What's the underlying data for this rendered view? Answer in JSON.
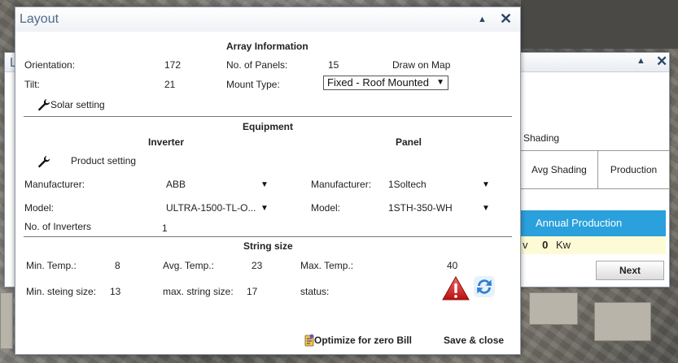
{
  "background_dialog": {
    "title_letter": "L",
    "shading_label": "Shading",
    "table_headers": {
      "avg_shading": "Avg Shading",
      "production": "Production"
    },
    "annual_production_label": "Annual Production",
    "annual_partial": "v",
    "annual_value": "0",
    "annual_unit": "Kw",
    "next_label": "Next"
  },
  "dialog": {
    "title": "Layout",
    "minimize_glyph": "▲",
    "close_glyph": "✕"
  },
  "array_info": {
    "section_title": "Array Information",
    "orientation_label": "Orientation:",
    "orientation_value": "172",
    "panels_label": "No. of Panels:",
    "panels_value": "15",
    "draw_on_map": "Draw on Map",
    "tilt_label": "Tilt:",
    "tilt_value": "21",
    "mount_label": "Mount Type:",
    "mount_value": "Fixed - Roof Mounted",
    "solar_setting": "Solar setting"
  },
  "equipment": {
    "section_title": "Equipment",
    "inverter_title": "Inverter",
    "panel_title": "Panel",
    "product_setting": "Product setting",
    "inv_manufacturer_label": "Manufacturer:",
    "inv_manufacturer_value": "ABB",
    "inv_model_label": "Model:",
    "inv_model_value": "ULTRA-1500-TL-O...",
    "inverters_label": "No. of Inverters",
    "inverters_value": "1",
    "panel_manufacturer_label": "Manufacturer:",
    "panel_manufacturer_value": "1Soltech",
    "panel_model_label": "Model:",
    "panel_model_value": "1STH-350-WH"
  },
  "string_size": {
    "section_title": "String size",
    "min_temp_label": "Min. Temp.:",
    "min_temp_value": "8",
    "avg_temp_label": "Avg. Temp.:",
    "avg_temp_value": "23",
    "max_temp_label": "Max. Temp.:",
    "max_temp_value": "40",
    "min_string_label": "Min. steing size:",
    "min_string_value": "13",
    "max_string_label": "max. string size:",
    "max_string_value": "17",
    "status_label": "status:"
  },
  "footer": {
    "optimize_label": "Optimize for zero Bill",
    "save_close_label": "Save & close"
  },
  "colors": {
    "title_text": "#4d6a8a",
    "annual_header": "#2aa0dc",
    "annual_row": "#fdfbd5",
    "warning": "#d62020",
    "refresh": "#2f7fd0"
  },
  "icons": {
    "wrench": "wrench-icon",
    "warning": "warning-icon",
    "refresh": "refresh-icon",
    "optimize": "optimize-icon"
  }
}
